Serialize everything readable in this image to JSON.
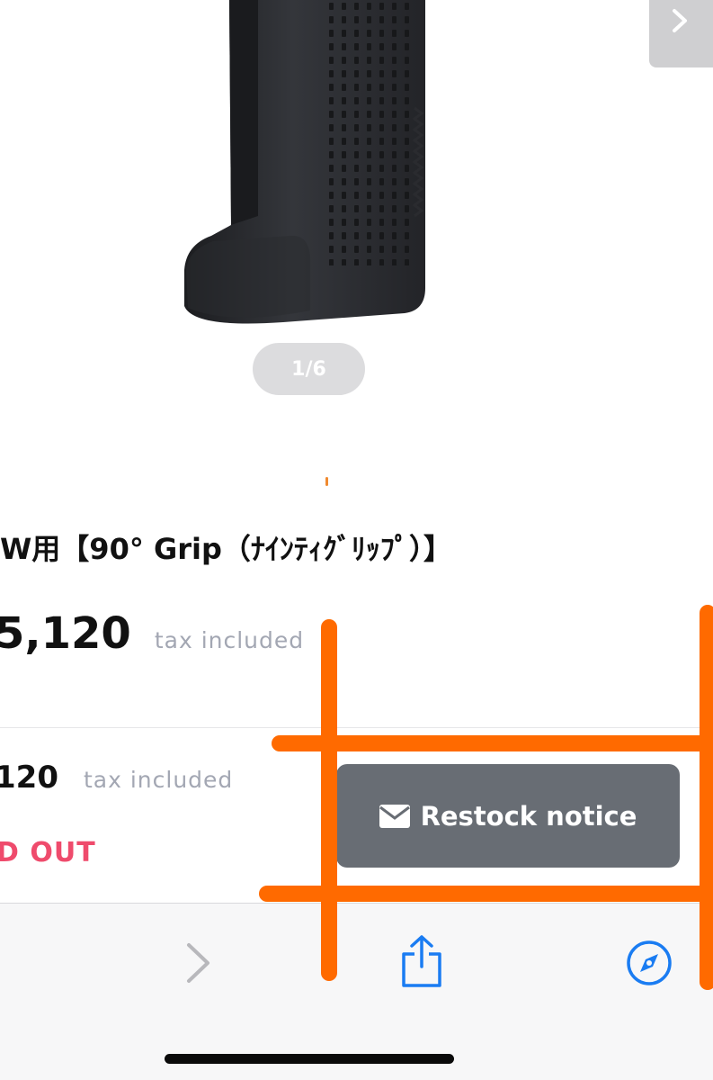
{
  "gallery": {
    "counter": "1/6"
  },
  "product": {
    "title": "W用【90° Grip（ﾅｲﾝﾃｨｸﾞﾘｯﾌﾟ）】",
    "price": "5,120",
    "tax_label": "tax included"
  },
  "buy_bar": {
    "price": "120",
    "tax_label": "tax included",
    "status": "D OUT",
    "restock_label": "Restock notice"
  },
  "colors": {
    "accent_annotation": "#ff6a00",
    "sold_out": "#ef4b6c",
    "restock_button": "#686d74",
    "safari_blue": "#1a7cf2"
  },
  "icons": [
    "chevron-right-icon",
    "mail-icon",
    "share-icon",
    "compass-icon"
  ]
}
